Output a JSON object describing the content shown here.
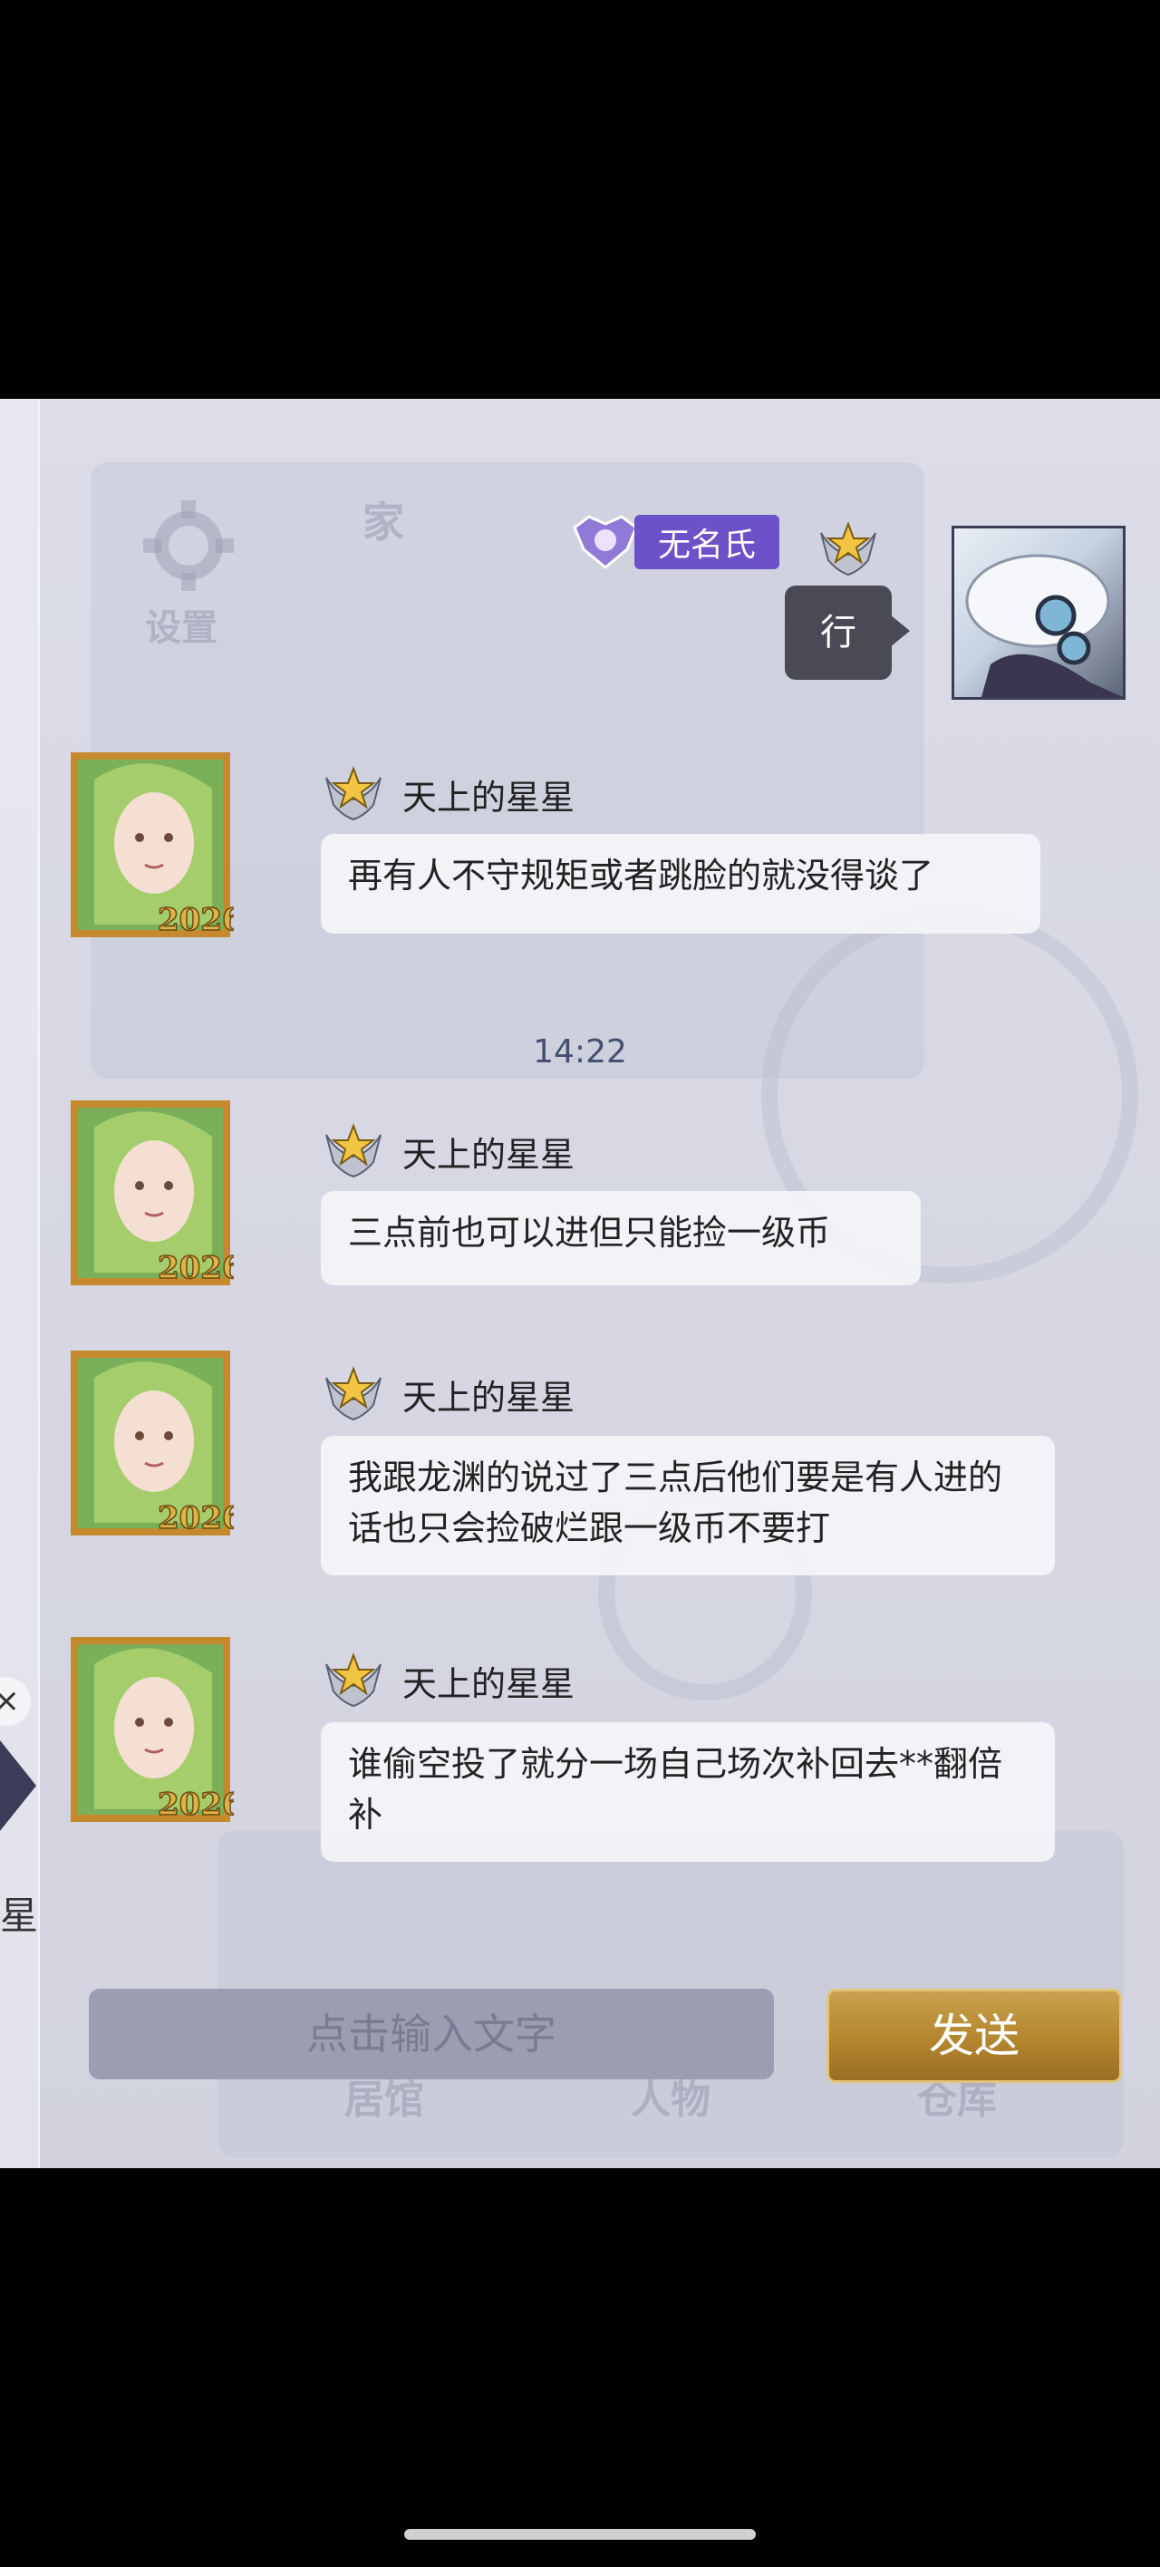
{
  "background": {
    "settings_label": "设置",
    "home_label": "家",
    "tabs": [
      "居馆",
      "人物",
      "仓库"
    ]
  },
  "left_panel": {
    "partial_char": "星"
  },
  "messages": [
    {
      "sender": "无名氏",
      "text": "行",
      "side": "right"
    },
    {
      "sender": "天上的星星",
      "text": "再有人不守规矩或者跳脸的就没得谈了",
      "side": "left"
    },
    {
      "sender": "天上的星星",
      "text": "三点前也可以进但只能捡一级币",
      "side": "left"
    },
    {
      "sender": "天上的星星",
      "text": "我跟龙渊的说过了三点后他们要是有人进的话也只会捡破烂跟一级币不要打",
      "side": "left"
    },
    {
      "sender": "天上的星星",
      "text": "谁偷空投了就分一场自己场次补回去**翻倍补",
      "side": "left"
    }
  ],
  "timestamp": "14:22",
  "input": {
    "placeholder": "点击输入文字"
  },
  "send_label": "发送",
  "colors": {
    "send_gold": "#b3862e",
    "name_tag": "#6b52c8",
    "input_bg": "#9c9db3"
  }
}
